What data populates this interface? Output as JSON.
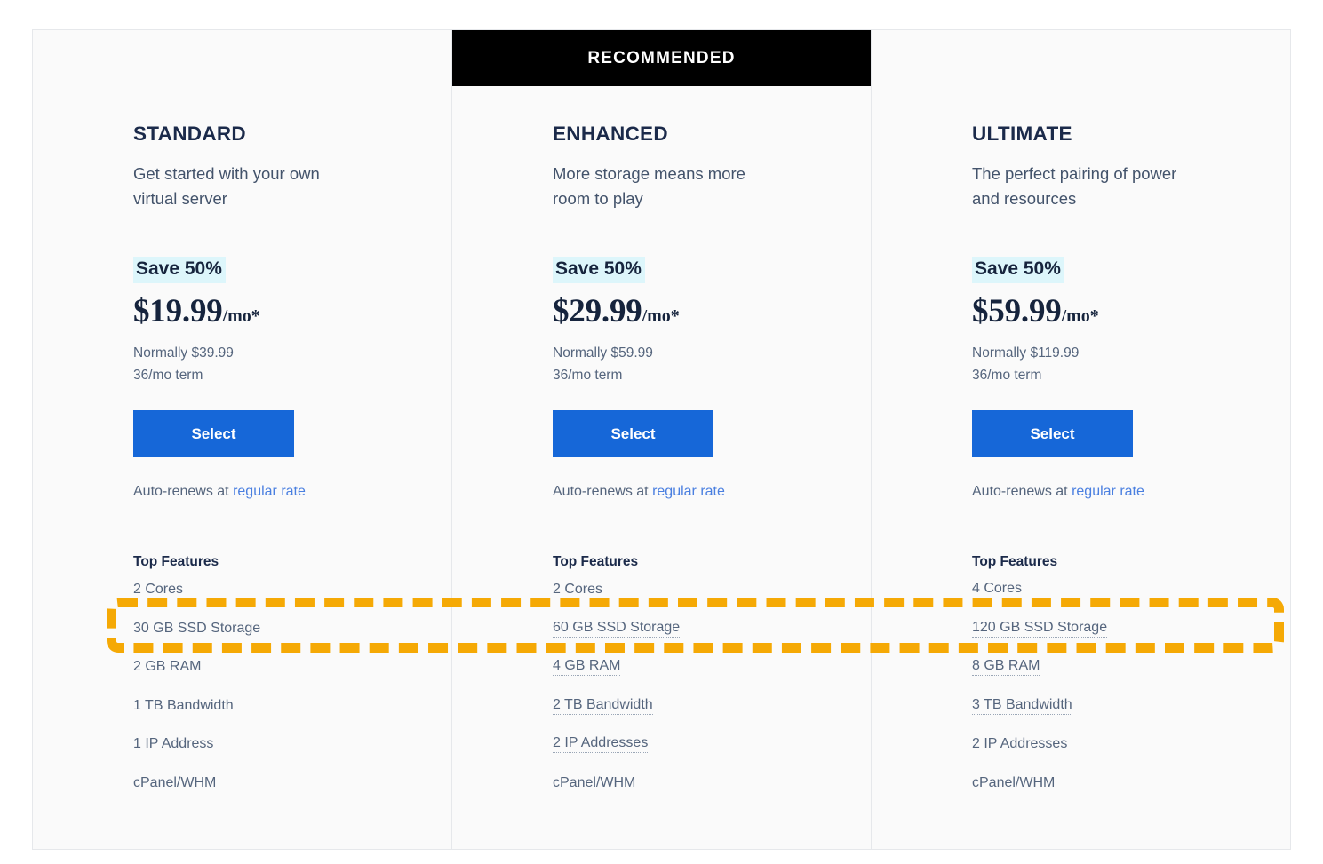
{
  "card": {
    "recommended_label": "RECOMMENDED",
    "features_heading": "Top Features",
    "select_label": "Select",
    "autorenew_prefix": "Auto-renews at ",
    "autorenew_link": "regular rate",
    "normally_prefix": "Normally ",
    "accent_blue": "#1667d8",
    "accent_link": "#4a7fe0",
    "save_highlight_bg": "#ddf6fb",
    "annotation_color": "#f5a905",
    "banner_bg": "#000000",
    "card_bg": "#fafafa"
  },
  "plans": [
    {
      "name": "STANDARD",
      "description": "Get started with your own virtual server",
      "recommended": false,
      "save_badge": "Save 50%",
      "price": "$19.99",
      "price_suffix": "/mo*",
      "normally_price": "$39.99",
      "term": "36/mo term",
      "features_heading": "Top Features",
      "features": [
        {
          "label": "2 Cores",
          "tooltip": false
        },
        {
          "label": "30 GB SSD Storage",
          "tooltip": false
        },
        {
          "label": "2 GB RAM",
          "tooltip": false
        },
        {
          "label": "1 TB Bandwidth",
          "tooltip": false
        },
        {
          "label": "1 IP Address",
          "tooltip": false
        },
        {
          "label": "cPanel/WHM",
          "tooltip": false
        }
      ]
    },
    {
      "name": "ENHANCED",
      "description": "More storage means more room to play",
      "recommended": true,
      "save_badge": "Save 50%",
      "price": "$29.99",
      "price_suffix": "/mo*",
      "normally_price": "$59.99",
      "term": "36/mo term",
      "features_heading": "Top Features",
      "features": [
        {
          "label": "2 Cores",
          "tooltip": false
        },
        {
          "label": "60 GB SSD Storage",
          "tooltip": true
        },
        {
          "label": "4 GB RAM",
          "tooltip": true
        },
        {
          "label": "2 TB Bandwidth",
          "tooltip": true
        },
        {
          "label": "2 IP Addresses",
          "tooltip": true
        },
        {
          "label": "cPanel/WHM",
          "tooltip": false
        }
      ]
    },
    {
      "name": "ULTIMATE",
      "description": "The perfect pairing of power and resources",
      "recommended": false,
      "save_badge": "Save 50%",
      "price": "$59.99",
      "price_suffix": "/mo*",
      "normally_price": "$119.99",
      "term": "36/mo term",
      "features_heading": "Top Features",
      "features": [
        {
          "label": "4 Cores",
          "tooltip": true
        },
        {
          "label": "120 GB SSD Storage",
          "tooltip": true
        },
        {
          "label": "8 GB RAM",
          "tooltip": true
        },
        {
          "label": "3 TB Bandwidth",
          "tooltip": true
        },
        {
          "label": "2 IP Addresses",
          "tooltip": false
        },
        {
          "label": "cPanel/WHM",
          "tooltip": false
        }
      ]
    }
  ],
  "annotation": {
    "name": "ssd-storage-row-highlight",
    "kind": "dashed-rectangle",
    "color": "#f5a905"
  }
}
